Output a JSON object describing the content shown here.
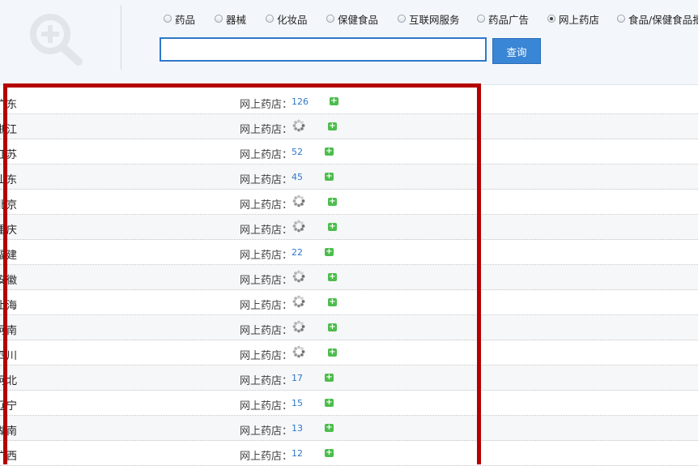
{
  "header": {
    "radio_options": [
      {
        "label": "药品",
        "checked": false
      },
      {
        "label": "器械",
        "checked": false
      },
      {
        "label": "化妆品",
        "checked": false
      },
      {
        "label": "保健食品",
        "checked": false
      },
      {
        "label": "互联网服务",
        "checked": false
      },
      {
        "label": "药品广告",
        "checked": false
      },
      {
        "label": "网上药店",
        "checked": true
      },
      {
        "label": "食品/保健食品批",
        "checked": false
      }
    ],
    "search_value": "",
    "search_button_label": "查询"
  },
  "results": [
    {
      "province": "广东",
      "label": "网上药店：",
      "count": "126",
      "loading": false
    },
    {
      "province": "浙江",
      "label": "网上药店：",
      "count": "",
      "loading": true
    },
    {
      "province": "江苏",
      "label": "网上药店：",
      "count": "52",
      "loading": false
    },
    {
      "province": "山东",
      "label": "网上药店：",
      "count": "45",
      "loading": false
    },
    {
      "province": "北京",
      "label": "网上药店：",
      "count": "",
      "loading": true
    },
    {
      "province": "重庆",
      "label": "网上药店：",
      "count": "",
      "loading": true
    },
    {
      "province": "福建",
      "label": "网上药店：",
      "count": "22",
      "loading": false
    },
    {
      "province": "安徽",
      "label": "网上药店：",
      "count": "",
      "loading": true
    },
    {
      "province": "上海",
      "label": "网上药店：",
      "count": "",
      "loading": true
    },
    {
      "province": "河南",
      "label": "网上药店：",
      "count": "",
      "loading": true
    },
    {
      "province": "四川",
      "label": "网上药店：",
      "count": "",
      "loading": true
    },
    {
      "province": "河北",
      "label": "网上药店：",
      "count": "17",
      "loading": false
    },
    {
      "province": "辽宁",
      "label": "网上药店：",
      "count": "15",
      "loading": false
    },
    {
      "province": "湖南",
      "label": "网上药店：",
      "count": "13",
      "loading": false
    },
    {
      "province": "广西",
      "label": "网上药店：",
      "count": "12",
      "loading": false
    }
  ],
  "colors": {
    "accent": "#2f78c8",
    "highlight_border": "#b40000",
    "expand_icon": "#4cbd4c"
  },
  "icons": {
    "logo": "zoom-in-magnifier-icon",
    "loading": "spinner-icon",
    "expand": "plus-icon"
  }
}
